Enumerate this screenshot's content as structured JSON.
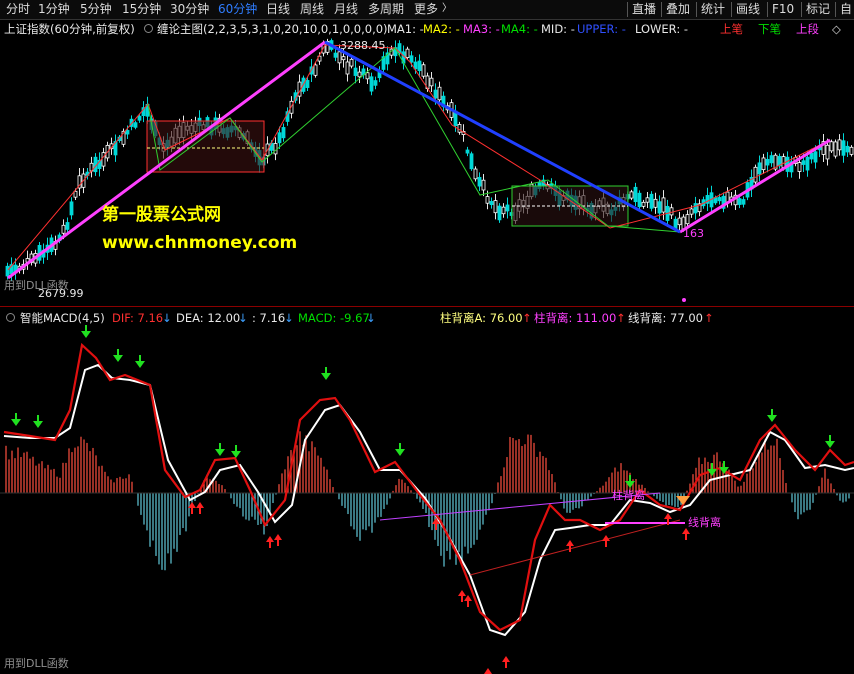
{
  "toolbar": {
    "periods": [
      {
        "label": "分时",
        "active": false
      },
      {
        "label": "1分钟",
        "active": false
      },
      {
        "label": "5分钟",
        "active": false
      },
      {
        "label": "15分钟",
        "active": false
      },
      {
        "label": "30分钟",
        "active": false
      },
      {
        "label": "60分钟",
        "active": true
      },
      {
        "label": "日线",
        "active": false
      },
      {
        "label": "周线",
        "active": false
      },
      {
        "label": "月线",
        "active": false
      },
      {
        "label": "多周期",
        "active": false
      },
      {
        "label": "更多",
        "active": false
      }
    ],
    "more_arrow": "〉",
    "right": [
      "直播",
      "叠加",
      "统计",
      "画线",
      "F10",
      "标记",
      "自"
    ]
  },
  "main_panel": {
    "instrument": "上证指数(60分钟,前复权)",
    "indicator": "缠论主图(2,2,3,5,3,1,0,20,10,0,1,0,0,0,0)",
    "ma_items": [
      {
        "label": "MA1: -",
        "color": "#e8e8e8"
      },
      {
        "label": "MA2: -",
        "color": "#ffff00"
      },
      {
        "label": "MA3: -",
        "color": "#ff40ff"
      },
      {
        "label": "MA4: -",
        "color": "#00e000"
      },
      {
        "label": "MID: -",
        "color": "#e8e8e8"
      },
      {
        "label": "UPPER: -",
        "color": "#3050ff"
      },
      {
        "label": "LOWER: -",
        "color": "#e8e8e8"
      }
    ],
    "legend": [
      {
        "label": "上笔",
        "color": "#ff3030"
      },
      {
        "label": "下笔",
        "color": "#00e000"
      },
      {
        "label": "上段",
        "color": "#ff40ff"
      },
      {
        "label": "◇",
        "color": "#d8d8d8"
      }
    ],
    "high_label": "3288.45",
    "low_label": "2679.99",
    "low2_label": "163",
    "dll_label": "用到DLL函数",
    "watermark_cn": "第一股票公式网",
    "watermark_url": "www.chnmoney.com"
  },
  "macd_panel": {
    "title": "智能MACD(4,5)",
    "dif_label": "DIF: 7.16",
    "dif_color": "#ff3030",
    "dea_label": "DEA: 12.00",
    "blank_label": ": 7.16",
    "macd_label": "MACD: -9.67",
    "macd_color": "#00e000",
    "bei_a_label": "柱背离A: 76.00",
    "bei_b_label": "柱背离: 111.00",
    "bei_b_color": "#ff40ff",
    "line_bei_label": "线背离: 77.00",
    "annotation_1": "柱背离",
    "annotation_2": "线背离",
    "dll_label": "用到DLL函数"
  }
}
